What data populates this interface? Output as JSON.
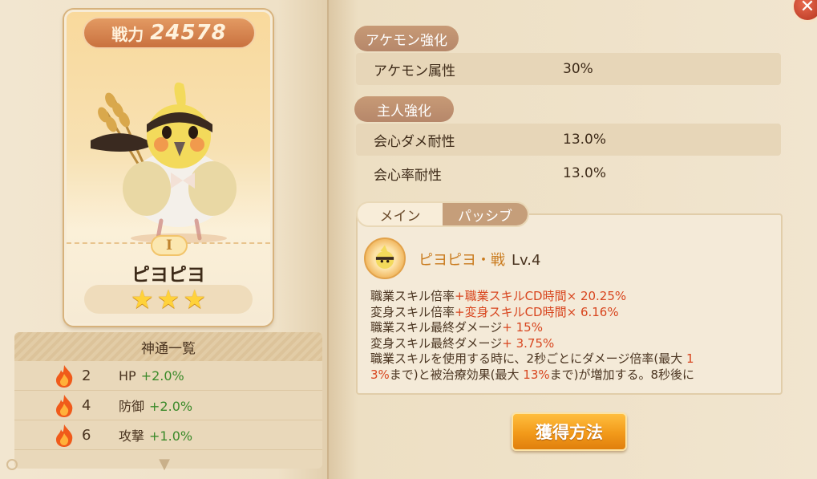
{
  "card": {
    "power_label": "戦力",
    "power_value": "24578",
    "rank": "I",
    "name": "ピヨピヨ",
    "stars": 3
  },
  "shintsu": {
    "title": "神通一覧",
    "rows": [
      {
        "level": "2",
        "stat": "HP",
        "value": "+2.0%"
      },
      {
        "level": "4",
        "stat": "防御",
        "value": "+2.0%"
      },
      {
        "level": "6",
        "stat": "攻撃",
        "value": "+1.0%"
      }
    ]
  },
  "akemon": {
    "section_title": "アケモン強化",
    "rows": [
      {
        "label": "アケモン属性",
        "value": "30%"
      }
    ]
  },
  "master": {
    "section_title": "主人強化",
    "rows": [
      {
        "label": "会心ダメ耐性",
        "value": "13.0%"
      },
      {
        "label": "会心率耐性",
        "value": "13.0%"
      }
    ]
  },
  "tabs": {
    "main": "メイン",
    "passive": "パッシブ"
  },
  "skill": {
    "name": "ピヨピヨ・戦",
    "level": "Lv.4",
    "lines": [
      {
        "text": "職業スキル倍率",
        "hl": "+職業スキルCD時間× 20.25%"
      },
      {
        "text": "変身スキル倍率",
        "hl": "+変身スキルCD時間× 6.16%"
      },
      {
        "text": "職業スキル最終ダメージ",
        "hl": "+ 15%"
      },
      {
        "text": "変身スキル最終ダメージ",
        "hl": "+ 3.75%"
      }
    ],
    "line5_text": "職業スキルを使用する時に、2秒ごとにダメージ倍率(最大 ",
    "line5_hl": "1",
    "line6_hl": "3%",
    "line6_a": "まで)と被治療効果(最大 ",
    "line6_hl2": "13%",
    "line6_b": "まで)が増加する。8秒後に"
  },
  "buttons": {
    "get_method": "獲得方法",
    "close": "✕"
  },
  "colors": {
    "highlight": "#d8461f",
    "stat_green": "#3b8a2a",
    "accent_orange": "#f29a1a"
  }
}
